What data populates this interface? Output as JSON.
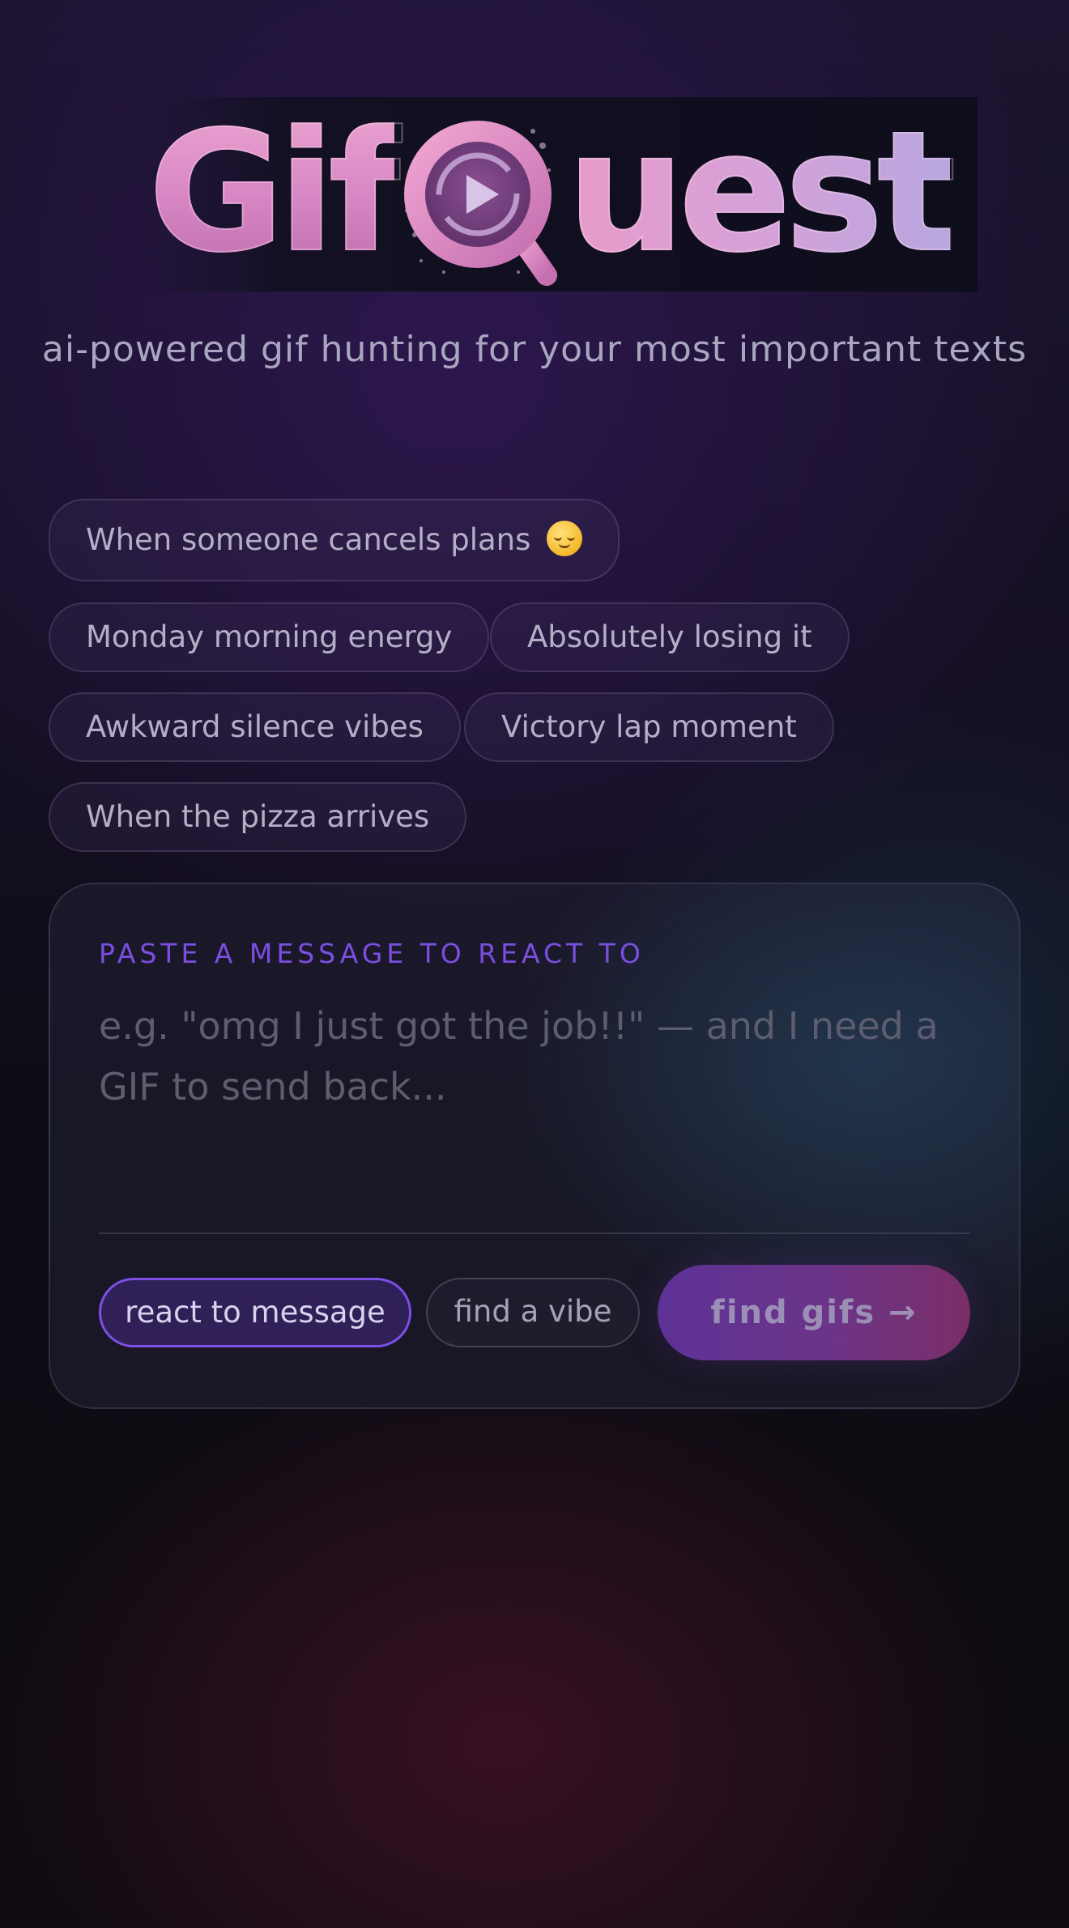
{
  "logo": {
    "part_left": "Gif",
    "part_right": "uest",
    "icon": "magnifier-play-icon"
  },
  "tagline": "ai-powered gif hunting for your most important texts",
  "suggestions": [
    {
      "label": "When someone cancels plans",
      "icon": "relieved-face-emoji"
    },
    {
      "label": "Monday morning energy"
    },
    {
      "label": "Absolutely losing it"
    },
    {
      "label": "Awkward silence vibes"
    },
    {
      "label": "Victory lap moment"
    },
    {
      "label": "When the pizza arrives"
    }
  ],
  "composer": {
    "label": "PASTE A MESSAGE TO REACT TO",
    "placeholder": "e.g. \"omg I just got the job!!\" — and I need a GIF to send back...",
    "value": "",
    "modes": [
      {
        "label": "react to message",
        "selected": true
      },
      {
        "label": "find a vibe",
        "selected": false
      }
    ],
    "submit_label": "find gifs →"
  },
  "colors": {
    "accent": "#7c4fe6",
    "label": "#7a4fe0",
    "button_gradient_start": "#5d3296",
    "button_gradient_end": "#7a2e66"
  }
}
